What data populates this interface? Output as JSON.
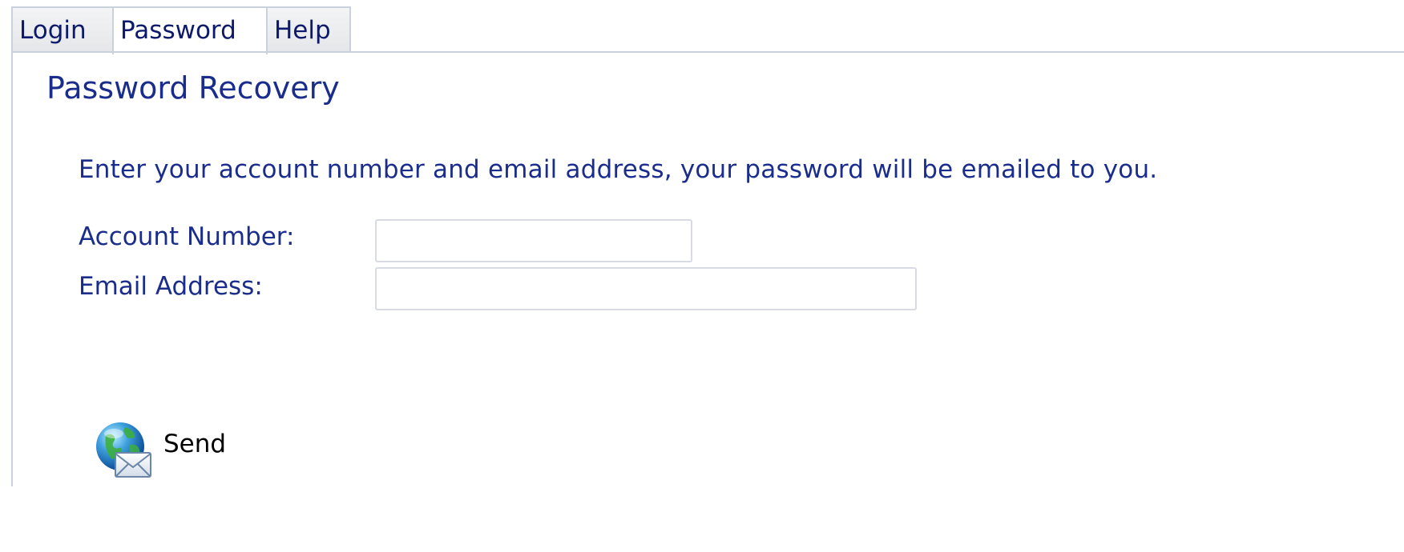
{
  "tabs": [
    {
      "label": "Login",
      "active": false
    },
    {
      "label": "Password",
      "active": true
    },
    {
      "label": "Help",
      "active": false
    }
  ],
  "page": {
    "title": "Password Recovery",
    "instructions": "Enter your account number and email address, your password will be emailed to you."
  },
  "form": {
    "account_label": "Account Number:",
    "account_value": "",
    "email_label": "Email Address:",
    "email_value": ""
  },
  "actions": {
    "send_label": "Send",
    "send_icon": "globe-envelope-icon"
  },
  "colors": {
    "text_accent": "#1a2d8c",
    "tab_border": "#c9d2dc",
    "input_border": "#d8dbe3"
  }
}
